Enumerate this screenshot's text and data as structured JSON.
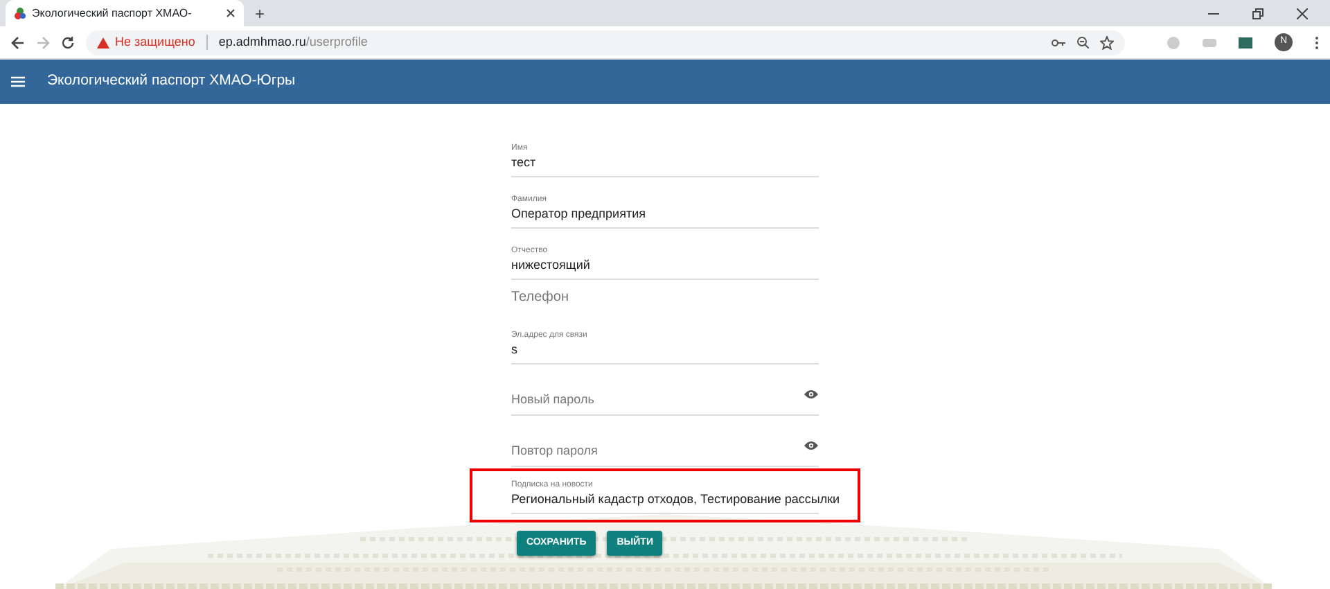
{
  "browser": {
    "tab_title": "Экологический паспорт ХМАО-",
    "new_tab": "+",
    "not_secure": "Не защищено",
    "url_host": "ep.admhmao.ru",
    "url_path": "/userprofile",
    "profile_initial": "N"
  },
  "app_bar": {
    "title": "Экологический паспорт ХМАО-Югры"
  },
  "fields": [
    {
      "kind": "filled",
      "label": "Имя",
      "value": "тест"
    },
    {
      "kind": "filled",
      "label": "Фамилия",
      "value": "Оператор предприятия"
    },
    {
      "kind": "filled",
      "label": "Отчество",
      "value": "нижестоящий"
    },
    {
      "kind": "empty",
      "placeholder": "Телефон"
    },
    {
      "kind": "filled",
      "label": "Эл.адрес для связи",
      "value": "s"
    },
    {
      "kind": "password",
      "placeholder": "Новый пароль"
    },
    {
      "kind": "password",
      "placeholder": "Повтор пароля"
    }
  ],
  "subscription": {
    "label": "Подписка на новости",
    "value": "Региональный кадастр отходов, Тестирование рассылки",
    "highlighted": true
  },
  "buttons": [
    "СОХРАНИТЬ",
    "ВЫЙТИ"
  ]
}
